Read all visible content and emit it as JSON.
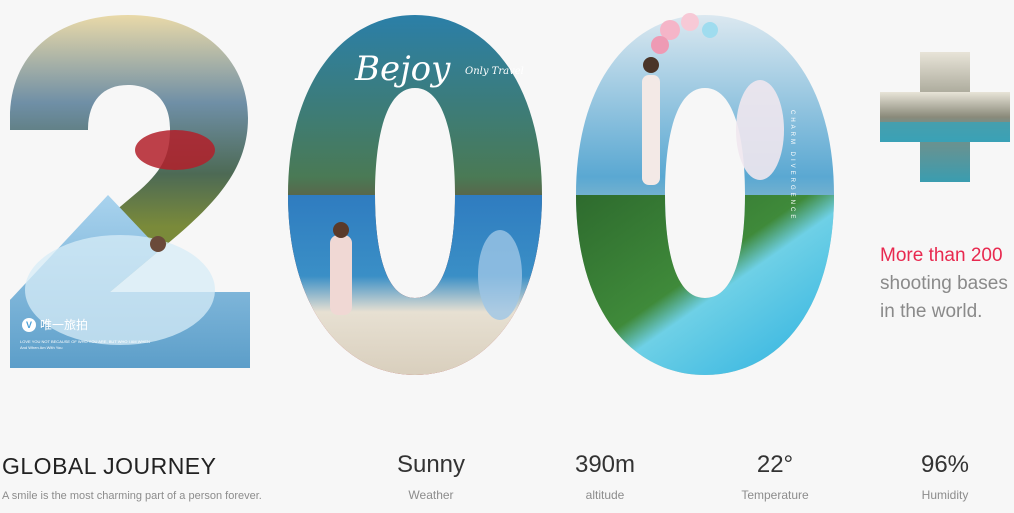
{
  "hero": {
    "digits": "200",
    "plus_symbol": "+",
    "script_caption": "Bejoy",
    "script_caption_small": "Only Travel",
    "vertical_caption": "CHARM DIVERGENCE",
    "brand_name": "唯一旅拍",
    "brand_mark": "V",
    "brand_small_line1": "LOVE YOU NOT BECAUSE OF WHO YOU ARE, BUT WHO I AM WHEN",
    "brand_small_line2": "And When Am With You"
  },
  "side": {
    "highlight": "More than 200",
    "rest": "shooting bases in the world."
  },
  "footer": {
    "title": "GLOBAL JOURNEY",
    "subtitle": "A smile is the most charming part of a person forever.",
    "stats": [
      {
        "value": "Sunny",
        "label": "Weather"
      },
      {
        "value": "390m",
        "label": "altitude"
      },
      {
        "value": "22°",
        "label": "Temperature"
      },
      {
        "value": "96%",
        "label": "Humidity"
      }
    ]
  },
  "colors": {
    "accent": "#e8294f",
    "text_dark": "#222222",
    "text_muted": "#8c8c8c",
    "background": "#f7f7f7"
  }
}
